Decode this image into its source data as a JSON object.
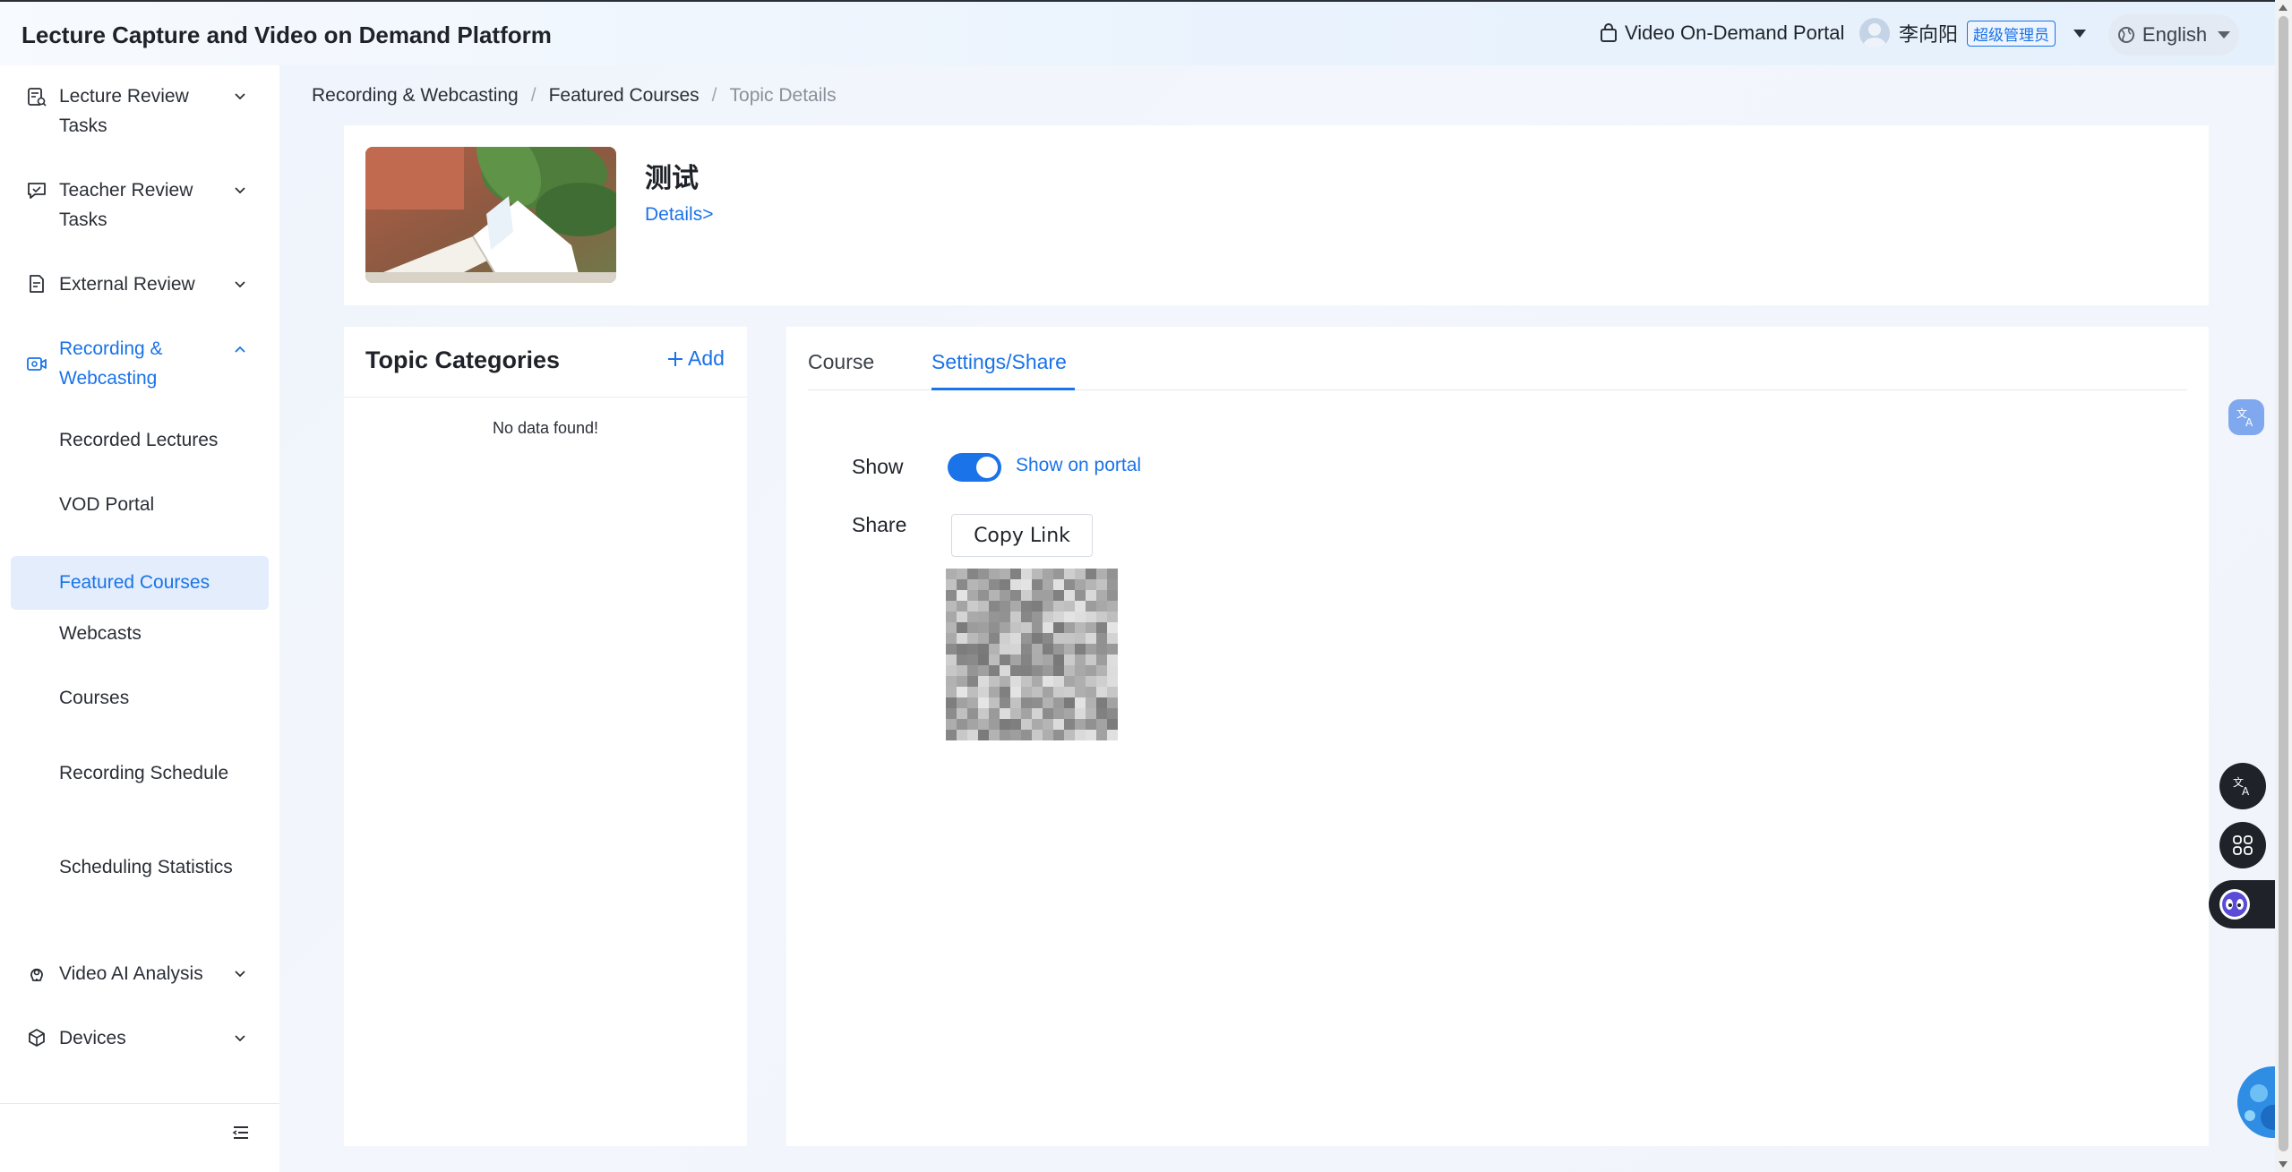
{
  "header": {
    "app_title": "Lecture Capture and Video on Demand Platform",
    "portal_link": "Video On-Demand Portal",
    "user_name": "李向阳",
    "user_role": "超级管理员",
    "language": "English"
  },
  "sidebar": {
    "items": [
      {
        "label": "Lecture Review Tasks",
        "icon": "review-task-icon"
      },
      {
        "label": "Teacher Review Tasks",
        "icon": "chat-check-icon"
      },
      {
        "label": "External Review",
        "icon": "document-icon"
      },
      {
        "label": "Recording & Webcasting",
        "icon": "camera-icon",
        "expanded": true
      },
      {
        "label": "Video AI Analysis",
        "icon": "ai-brain-icon"
      },
      {
        "label": "Devices",
        "icon": "cube-icon"
      }
    ],
    "subitems": [
      {
        "label": "Recorded Lectures"
      },
      {
        "label": "VOD Portal"
      },
      {
        "label": "Featured Courses",
        "selected": true
      },
      {
        "label": "Webcasts"
      },
      {
        "label": "Courses"
      },
      {
        "label": "Recording Schedule"
      },
      {
        "label": "Scheduling Statistics"
      }
    ]
  },
  "breadcrumb": [
    "Recording & Webcasting",
    "Featured Courses",
    "Topic Details"
  ],
  "topic": {
    "title": "测试",
    "details_link": "Details>"
  },
  "categories": {
    "title": "Topic Categories",
    "add_label": "Add",
    "empty_text": "No data found!"
  },
  "main": {
    "tabs": [
      "Course",
      "Settings/Share"
    ],
    "active_tab": "Settings/Share",
    "show_label": "Show",
    "show_toggle_on": true,
    "show_toggle_text": "Show on portal",
    "share_label": "Share",
    "copy_link_label": "Copy Link"
  },
  "colors": {
    "accent": "#1a73e8",
    "selected_bg": "#e3edfc",
    "text": "#1f2329"
  }
}
